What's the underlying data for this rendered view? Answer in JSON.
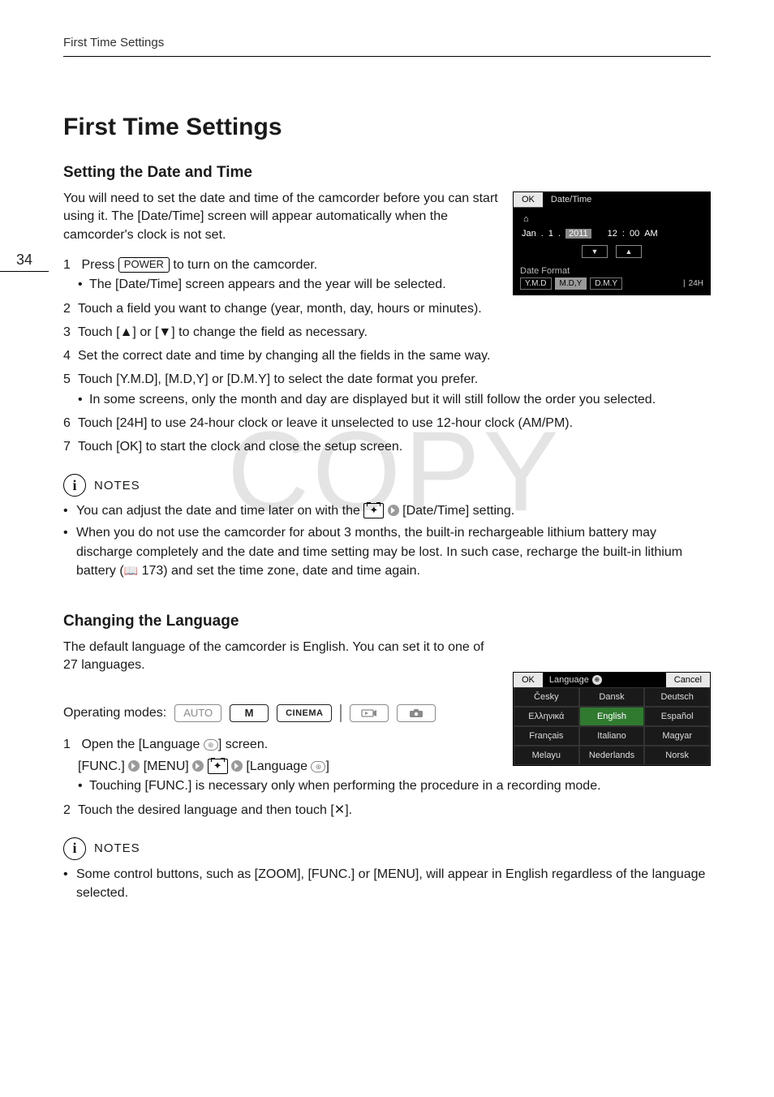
{
  "running_head": "First Time Settings",
  "page_number": "34",
  "title": "First Time Settings",
  "watermark": "COPY",
  "section_date": {
    "heading": "Setting the Date and Time",
    "intro": "You will need to set the date and time of the camcorder before you can start using it. The [Date/Time] screen will appear automatically when the camcorder's clock is not set.",
    "steps": {
      "s1_pre": "Press ",
      "s1_btn": "POWER",
      "s1_post": " to turn on the camcorder.",
      "s1_sub": "The [Date/Time] screen appears and the year will be selected.",
      "s2": "Touch a field you want to change (year, month, day, hours or minutes).",
      "s3": "Touch [▲] or [▼] to change the field as necessary.",
      "s4": "Set the correct date and time by changing all the fields in the same way.",
      "s5": "Touch [Y.M.D], [M.D,Y] or [D.M.Y] to select the date format you prefer.",
      "s5_sub": "In some screens, only the month and day are displayed but it will still follow the order you selected.",
      "s6": "Touch [24H] to use 24-hour clock or leave it unselected to use 12-hour clock (AM/PM).",
      "s7": "Touch [OK] to start the clock and close the setup screen."
    },
    "notes_label": "NOTES",
    "notes": {
      "n1_pre": "You can adjust the date and time later on with the ",
      "n1_post": " [Date/Time] setting.",
      "n2_a": "When you do not use the camcorder for about 3 months, the built-in rechargeable lithium battery may discharge completely and the date and time setting may be lost. In such case, recharge the built-in lithium battery (",
      "n2_page": "173",
      "n2_b": ") and set the time zone, date and time again."
    }
  },
  "dt_shot": {
    "ok": "OK",
    "title": "Date/Time",
    "month": "Jan",
    "sep": ".",
    "day": "1",
    "year": "2011",
    "hour": "12",
    "colon": ":",
    "min": "00",
    "ampm": "AM",
    "down": "▼",
    "up": "▲",
    "df_label": "Date Format",
    "df1": "Y.M.D",
    "df2": "M.D,Y",
    "df3": "D.M.Y",
    "h24": "24H"
  },
  "section_lang": {
    "heading": "Changing the Language",
    "intro": "The default language of the camcorder is English. You can set it to one of 27 languages.",
    "op_label": "Operating modes:",
    "modes": {
      "auto": "AUTO",
      "m": "M",
      "cinema": "CINEMA"
    },
    "steps": {
      "s1_pre": "Open the [Language ",
      "s1_post": "] screen.",
      "s1_path_func": "[FUNC.]",
      "s1_path_menu": "[MENU]",
      "s1_path_lang": "[Language ",
      "s1_path_lang_end": "]",
      "s1_sub": "Touching [FUNC.] is necessary only when performing the procedure in a recording mode.",
      "s2": "Touch the desired language and then touch [✕]."
    },
    "notes_label": "NOTES",
    "note1": "Some control buttons, such as [ZOOM], [FUNC.] or [MENU], will appear in English regardless of the language selected."
  },
  "lang_shot": {
    "ok": "OK",
    "title": "Language",
    "cancel": "Cancel",
    "cells": [
      "Česky",
      "Dansk",
      "Deutsch",
      "Ελληνικά",
      "English",
      "Español",
      "Français",
      "Italiano",
      "Magyar",
      "Melayu",
      "Nederlands",
      "Norsk"
    ],
    "selected_index": 4
  },
  "icons": {
    "wrench": "🔧",
    "book": "📖",
    "home": "⌂"
  }
}
